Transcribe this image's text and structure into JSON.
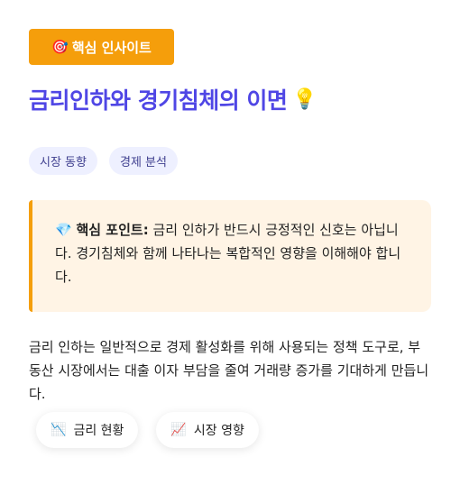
{
  "badge": {
    "icon": "🎯",
    "label": "핵심 인사이트"
  },
  "title": {
    "text": "금리인하와 경기침체의 이면",
    "icon": "💡"
  },
  "tags": [
    "시장 동향",
    "경제 분석"
  ],
  "callout": {
    "icon": "💎",
    "label": "핵심 포인트:",
    "text": "금리 인하가 반드시 긍정적인 신호는 아닙니다. 경기침체와 함께 나타나는 복합적인 영향을 이해해야 합니다."
  },
  "body": "금리 인하는 일반적으로 경제 활성화를 위해 사용되는 정책 도구로, 부동산 시장에서는 대출 이자 부담을 줄여 거래량 증가를 기대하게 만듭니다.",
  "actions": [
    {
      "icon": "📉",
      "label": "금리 현황"
    },
    {
      "icon": "📈",
      "label": "시장 영향"
    }
  ],
  "colors": {
    "accent": "#f59e0b",
    "title": "#4f46e5",
    "tag_bg": "#eef0ff",
    "callout_bg": "#fff4e5"
  }
}
